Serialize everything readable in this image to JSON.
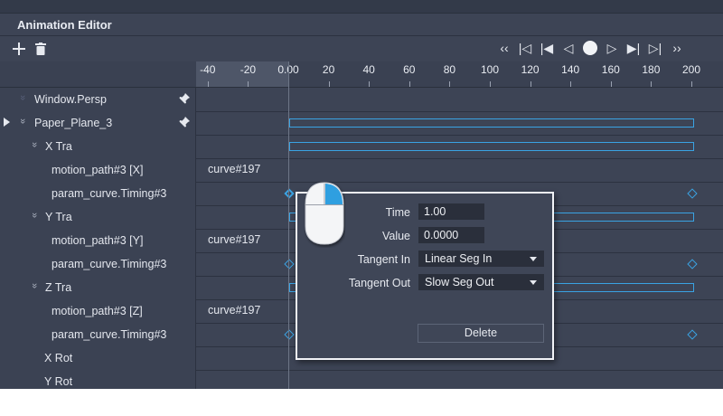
{
  "window": {
    "title": "Animation Editor"
  },
  "toolbar": {
    "add_icon": "plus-icon",
    "delete_icon": "trash-icon",
    "transport": [
      {
        "name": "rewind-icon",
        "glyph": "‹‹"
      },
      {
        "name": "first-keyframe-icon",
        "glyph": "|◁"
      },
      {
        "name": "skip-start-icon",
        "glyph": "|◀"
      },
      {
        "name": "step-back-icon",
        "glyph": "◁"
      },
      {
        "name": "record-icon",
        "glyph": "●"
      },
      {
        "name": "play-icon",
        "glyph": "▷"
      },
      {
        "name": "skip-end-icon",
        "glyph": "▶|"
      },
      {
        "name": "last-keyframe-icon",
        "glyph": "▷|"
      },
      {
        "name": "fast-forward-icon",
        "glyph": "››"
      }
    ]
  },
  "ruler": {
    "ticks": [
      "-40",
      "-20",
      "0.00",
      "20",
      "40",
      "60",
      "80",
      "100",
      "120",
      "140",
      "160",
      "180",
      "200"
    ]
  },
  "tracks": [
    {
      "label": "Window.Persp",
      "curve": "",
      "pinned": true
    },
    {
      "label": "Paper_Plane_3",
      "curve": "",
      "pinned": true,
      "expander": true
    },
    {
      "label": "X Tra",
      "curve": ""
    },
    {
      "label": "motion_path#3 [X]",
      "curve": "curve#197"
    },
    {
      "label": "param_curve.Timing#3",
      "curve": ""
    },
    {
      "label": "Y Tra",
      "curve": ""
    },
    {
      "label": "motion_path#3 [Y]",
      "curve": "curve#197"
    },
    {
      "label": "param_curve.Timing#3",
      "curve": ""
    },
    {
      "label": "Z Tra",
      "curve": ""
    },
    {
      "label": "motion_path#3 [Z]",
      "curve": "curve#197"
    },
    {
      "label": "param_curve.Timing#3",
      "curve": ""
    },
    {
      "label": "X Rot",
      "curve": ""
    },
    {
      "label": "Y Rot",
      "curve": ""
    }
  ],
  "keyframe_popup": {
    "time_label": "Time",
    "time_value": "1.00",
    "value_label": "Value",
    "value_value": "0.0000",
    "tangent_in_label": "Tangent In",
    "tangent_in_value": "Linear Seg In",
    "tangent_out_label": "Tangent Out",
    "tangent_out_value": "Slow Seg Out",
    "delete_label": "Delete"
  },
  "colors": {
    "accent": "#3aa3e3",
    "panel": "#3d4455"
  }
}
